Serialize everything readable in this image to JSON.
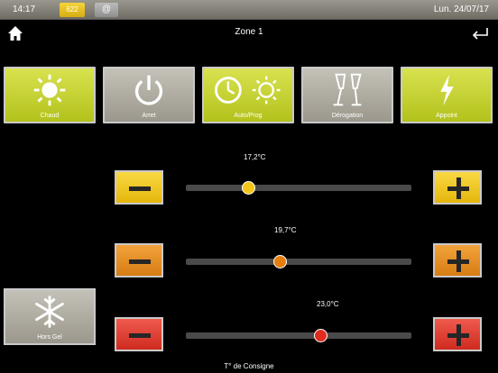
{
  "status": {
    "time": "14:17",
    "badge": "622",
    "at_symbol": "@",
    "date": "Lun. 24/07/17"
  },
  "header": {
    "title": "Zone 1",
    "home_icon": "home-icon",
    "back_icon": "return-arrow-icon"
  },
  "modes": [
    {
      "label": "Chaud",
      "icon": "sun-icon",
      "state": "active"
    },
    {
      "label": "Arret",
      "icon": "power-icon",
      "state": "inactive"
    },
    {
      "label": "Auto/Prog",
      "icon": "clock-sun-icon",
      "state": "active"
    },
    {
      "label": "Dérogation",
      "icon": "glasses-icon",
      "state": "inactive"
    },
    {
      "label": "Appoint",
      "icon": "lightning-icon",
      "state": "active"
    }
  ],
  "setpoints": [
    {
      "value": "17,2°C",
      "level": 0.28,
      "color": "#f5c518"
    },
    {
      "value": "19,7°C",
      "level": 0.42,
      "color": "#e67e0f"
    },
    {
      "value": "23,0°C",
      "level": 0.6,
      "color": "#e02b1f"
    }
  ],
  "hors_gel": {
    "label": "Hors Gel",
    "icon": "snowflake-icon"
  },
  "footer": {
    "label": "T° de Consigne"
  },
  "colors": {
    "yellow_green": "#c6d332",
    "grey": "#b0ada3",
    "yellow": "#f5c518",
    "orange": "#e68a1e",
    "red": "#e03a2e"
  }
}
